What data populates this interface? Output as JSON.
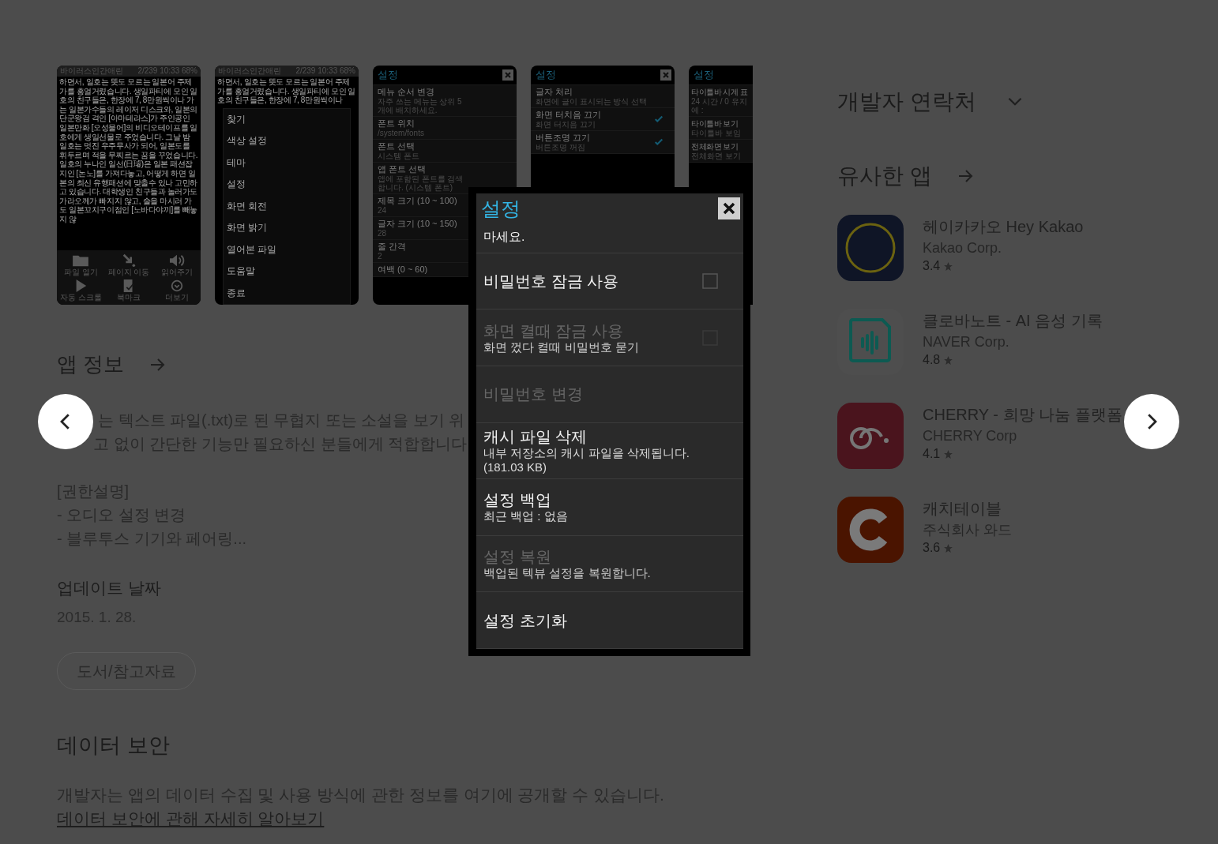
{
  "screenshots": [
    {
      "kind": "reader",
      "status_left": "바이러스인간애린",
      "status_right": "2/239 10:33 68%",
      "text": "하면서, 일호는 뜻도 모르는 일본어 주제가를 흥얼거렸습니다. 생일파티에 모인 일호의 친구들은, 한장에 7, 8만원씩이나 가는 일본가수들의 레이저 디스크와, 일본의 단군왕검 격인 [아마테라스]가 주인공인 일본만화 [오성물어]의 비디오테이프를 일호에게 생일선물로 주었습니다. 그날 밤 일호는 멋진 우주무사가 되어, 일본도를 휘두르며 적을 무찌르는 꿈을 꾸었습니다. 일호의 누나인 일선(日璿)은 일본 패션잡지인 [논노]를 가져다놓고, 어떻게 하면 일본의 최신 유행패션에 맞출수 있나 고민하고 있습니다. 대학생인 친구들과 놀러가도 가라오께가 빠지지 않고, 술을 마시러 가도 일본꼬치구이점인 [노바다야끼]를 빼놓지 않",
      "toolbar": [
        "파일 열기",
        "페이지 이동",
        "읽어주기",
        "자동 스크롤",
        "북마크",
        "더보기"
      ]
    },
    {
      "kind": "menu",
      "status_left": "바이러스인간애린",
      "status_right": "2/239 10:33 68%",
      "text": "하면서, 일호는 뜻도 모르는 일본어 주제가를 흥얼거렸습니다. 생일파티에 모인 일호의 친구들은, 한장에 7, 8만원씩이나",
      "menu": [
        "찾기",
        "색상 설정",
        "테마",
        "설정",
        "화면 회전",
        "화면 밝기",
        "열어본 파일",
        "도움말",
        "종료"
      ]
    },
    {
      "kind": "settings",
      "title": "설정",
      "close_button": true,
      "items": [
        {
          "kind": "plain",
          "title": "메뉴 순서 변경",
          "subtitle": "자주 쓰는 메뉴는 상위 5개에 배치하세요."
        },
        {
          "kind": "plain",
          "title": "폰트 위치",
          "subtitle": "/system/fonts"
        },
        {
          "kind": "plain",
          "title": "폰트 선택",
          "subtitle": "시스템 폰트"
        },
        {
          "kind": "plain",
          "title": "앱 폰트 선택",
          "subtitle": "앱에 포함된 폰트를 검색합니다. (시스템 폰트)"
        },
        {
          "kind": "plain",
          "title": "제목 크기 (10 ~ 100)",
          "subtitle": "24"
        },
        {
          "kind": "plain",
          "title": "글자 크기 (10 ~ 150)",
          "subtitle": "28"
        },
        {
          "kind": "plain",
          "title": "줄 간격",
          "subtitle": "2"
        },
        {
          "kind": "plain",
          "title": "여백 (0 ~ 60)"
        }
      ]
    },
    {
      "kind": "settings",
      "title": "설정",
      "close_button": true,
      "items": [
        {
          "kind": "plain",
          "title": "글자 처리",
          "subtitle": "화면에 글이 표시되는 방식 선택"
        },
        {
          "kind": "check",
          "title": "화면 터치음 끄기",
          "subtitle": "화면 터치음 끄기",
          "checked": true
        },
        {
          "kind": "check",
          "title": "버튼조명 끄기",
          "subtitle": "버튼조명 꺼짐",
          "checked": true
        }
      ]
    },
    {
      "kind": "settings",
      "title": "설정",
      "close_button": false,
      "items": [
        {
          "kind": "plain",
          "title": "타이틀바 시계 표",
          "subtitle": "24 시간 / 0 유지 예 :"
        },
        {
          "kind": "plain",
          "title": "타이틀바 보기",
          "subtitle": "타이틀바 보임"
        },
        {
          "kind": "plain",
          "title": "전체화면 보기",
          "subtitle": "전체화면 보기"
        }
      ]
    }
  ],
  "app_info": {
    "heading": "앱 정보",
    "description": [
      "는 텍스트 파일(.txt)로 된 무협지 또는 소설을 보기 위",
      "고 없이 간단한 기능만 필요하신 분들에게 적합합니다."
    ],
    "permissions": [
      "[권한설명]",
      "- 오디오 설정 변경",
      "- 블루투스 기기와 페어링..."
    ],
    "update_label": "업데이트 날짜",
    "update_date": "2015. 1. 28.",
    "category": "도서/참고자료"
  },
  "data_safety": {
    "heading": "데이터 보안",
    "text": "개발자는 앱의 데이터 수집 및 사용 방식에 관한 정보를 여기에 공개할 수 있습니다.",
    "link": "데이터 보안에 관해 자세히 알아보기"
  },
  "developer_contact": {
    "heading": "개발자 연락처"
  },
  "similar_apps": {
    "heading": "유사한 앱",
    "apps": [
      {
        "name": "헤이카카오 Hey Kakao",
        "developer": "Kakao Corp.",
        "rating": "3.4"
      },
      {
        "name": "클로바노트 - AI 음성 기록",
        "developer": "NAVER Corp.",
        "rating": "4.8"
      },
      {
        "name": "CHERRY - 희망 나눔 플랫폼",
        "developer": "CHERRY Corp",
        "rating": "4.1"
      },
      {
        "name": "캐치테이블",
        "developer": "주식회사 와드",
        "rating": "3.6"
      }
    ]
  },
  "viewer": {
    "title": "설정",
    "items": [
      {
        "kind": "fragment",
        "title": "마세요.",
        "disabled": false
      },
      {
        "kind": "check",
        "title": "비밀번호 잠금 사용",
        "checked": false,
        "disabled": false
      },
      {
        "kind": "check",
        "title": "화면 켤때 잠금 사용",
        "subtitle": "화면 껐다 켤때 비밀번호 묻기",
        "checked": false,
        "disabled": true
      },
      {
        "kind": "plain",
        "title": "비밀번호 변경",
        "disabled": true
      },
      {
        "kind": "plain",
        "title": "캐시 파일 삭제",
        "subtitle": "내부 저장소의 캐시 파일을 삭제됩니다. (181.03 KB)",
        "disabled": false
      },
      {
        "kind": "plain",
        "title": "설정 백업",
        "subtitle": "최근 백업 : 없음",
        "disabled": false
      },
      {
        "kind": "plain",
        "title": "설정 복원",
        "subtitle": "백업된 텍뷰 설정을 복원합니다.",
        "disabled": true
      },
      {
        "kind": "plain",
        "title": "설정 초기화",
        "disabled": false
      }
    ]
  }
}
